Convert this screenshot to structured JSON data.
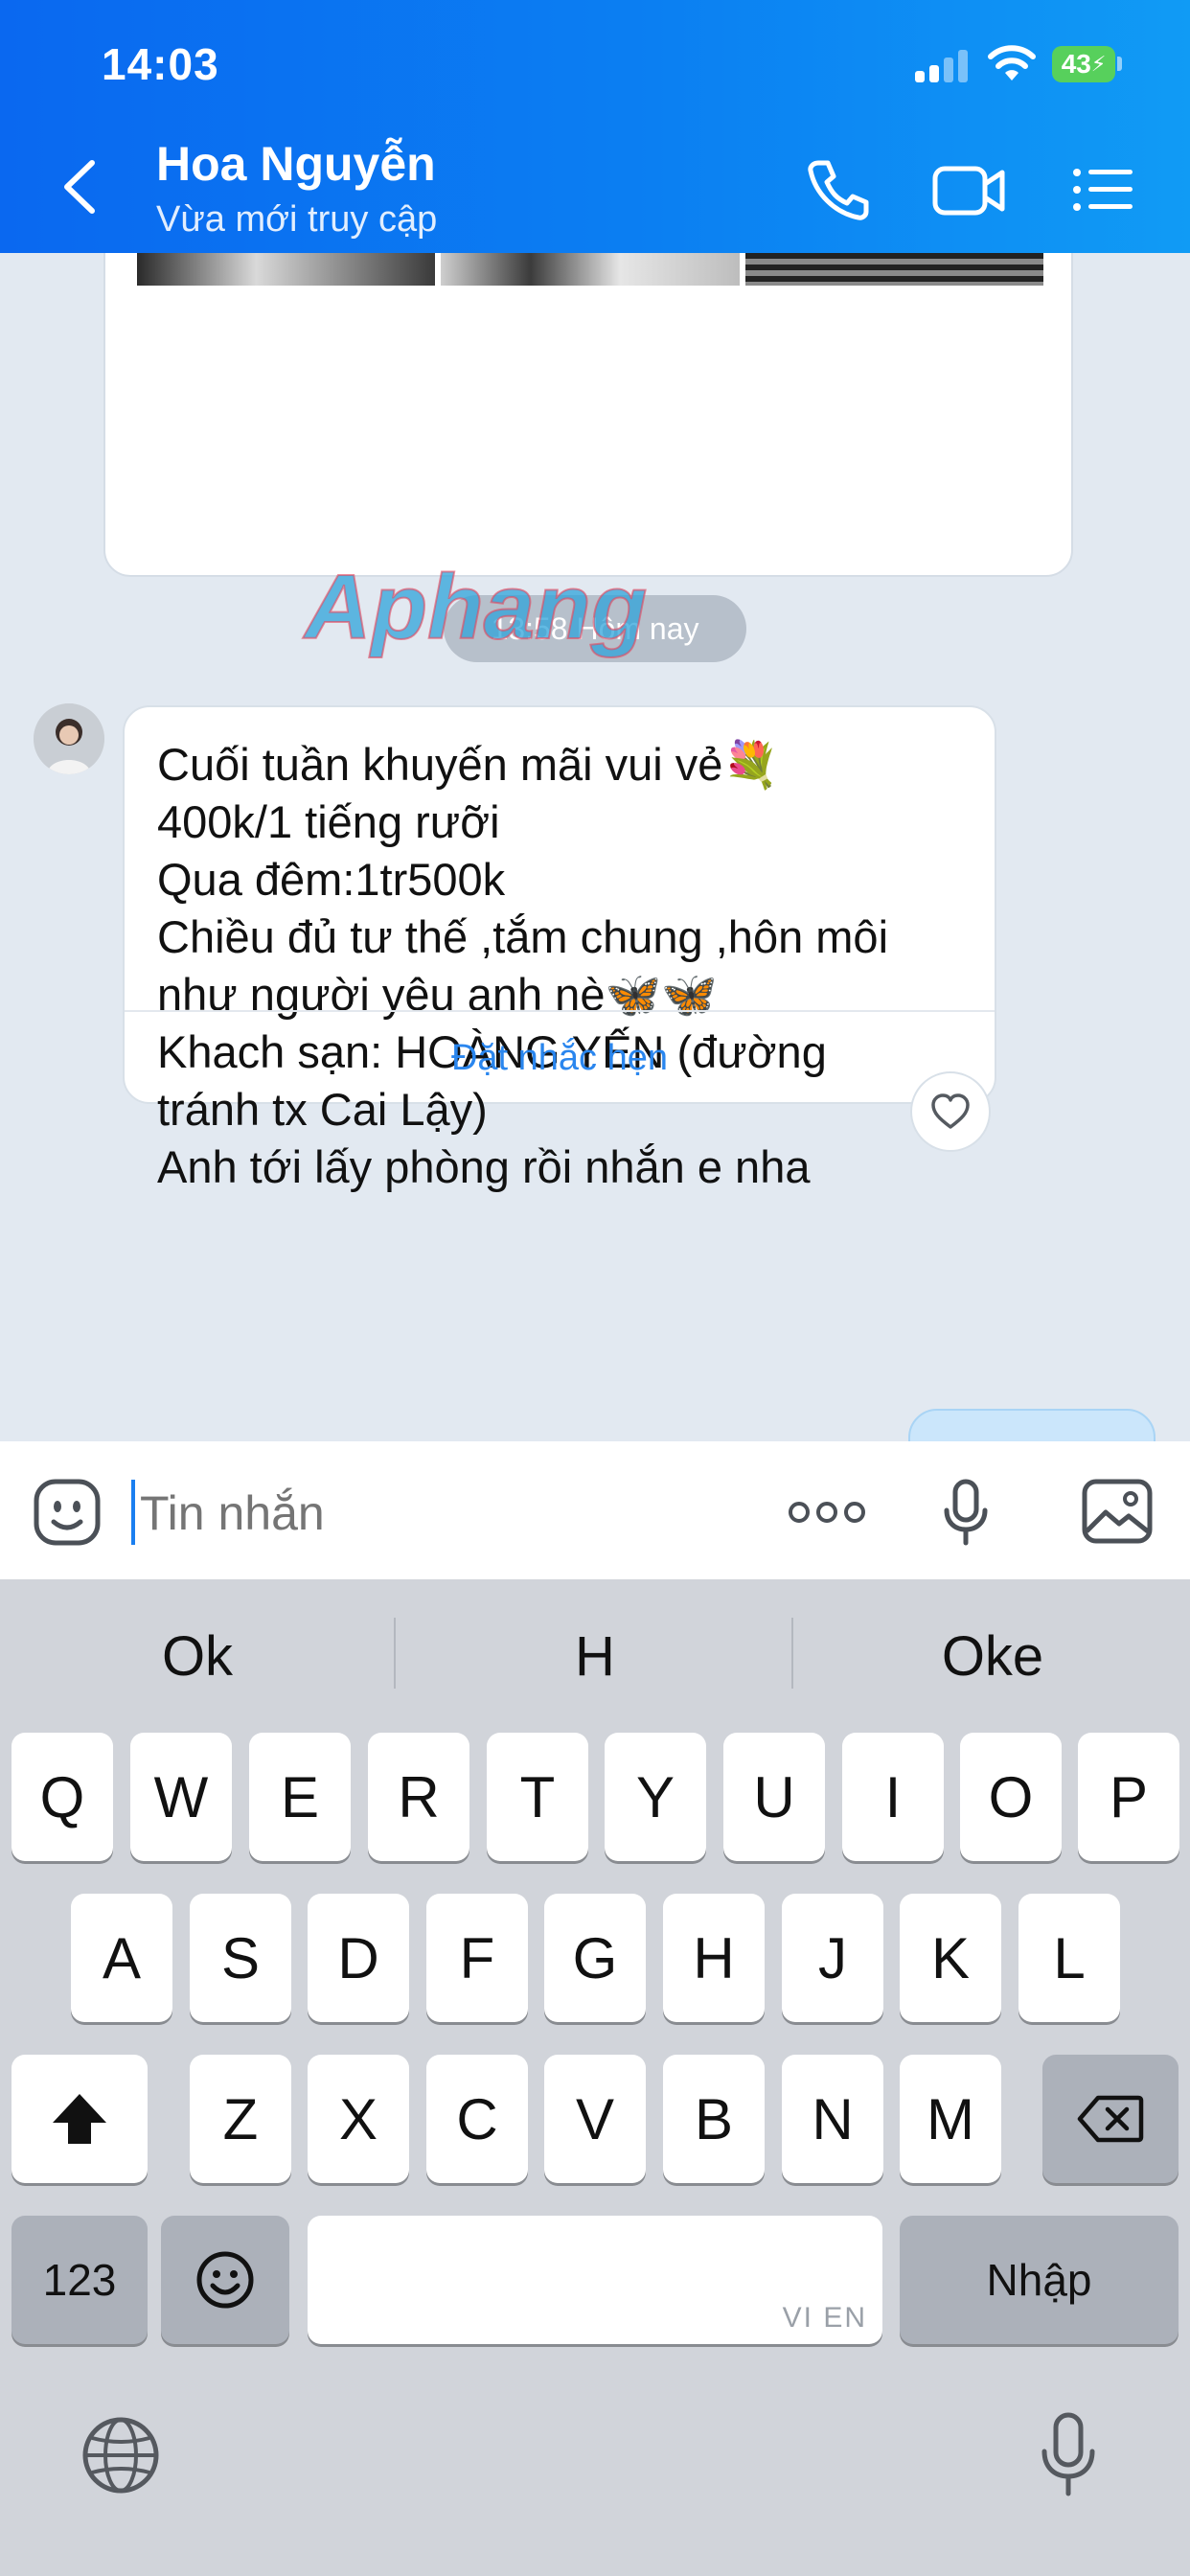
{
  "status_bar": {
    "time": "14:03",
    "battery": "43"
  },
  "header": {
    "contact_name": "Hoa Nguyễn",
    "contact_status": "Vừa mới truy cập"
  },
  "chat": {
    "time_separator": "13:58 Hôm nay",
    "message": {
      "lines": [
        "Cuối tuần khuyến mãi vui vẻ💐",
        "400k/1 tiếng rưỡi",
        "Qua đêm:1tr500k",
        "Chiều đủ tư thế ,tắm chung ,hôn môi",
        "như người yêu anh nè🦋🦋",
        "Khach sạn: HOÀNG YẾN (đường",
        "tránh tx Cai Lậy)",
        "Anh tới lấy phòng rồi nhắn e nha"
      ],
      "action_label": "Đặt nhắc hẹn"
    },
    "watermark_text": "Aphang"
  },
  "composer": {
    "placeholder": "Tin nhắn"
  },
  "keyboard": {
    "suggestions": [
      "Ok",
      "H",
      "Oke"
    ],
    "row1": [
      "Q",
      "W",
      "E",
      "R",
      "T",
      "Y",
      "U",
      "I",
      "O",
      "P"
    ],
    "row2": [
      "A",
      "S",
      "D",
      "F",
      "G",
      "H",
      "J",
      "K",
      "L"
    ],
    "row3": [
      "Z",
      "X",
      "C",
      "V",
      "B",
      "N",
      "M"
    ],
    "numbers_label": "123",
    "space_hint": "VI EN",
    "return_label": "Nhập"
  },
  "colors": {
    "header_start": "#0a68f0",
    "header_end": "#109bf5",
    "chat_background": "#e2e9f1",
    "link_blue": "#2a86ee",
    "keyboard_bg": "#d1d4da"
  },
  "icons": {
    "header": [
      "back-icon",
      "phone-icon",
      "video-icon",
      "menu-list-icon"
    ],
    "composer": [
      "sticker-icon",
      "more-icon",
      "microphone-icon",
      "image-icon"
    ],
    "keyboard": [
      "shift-icon",
      "backspace-icon",
      "emoji-icon",
      "globe-icon",
      "dictation-icon"
    ]
  }
}
